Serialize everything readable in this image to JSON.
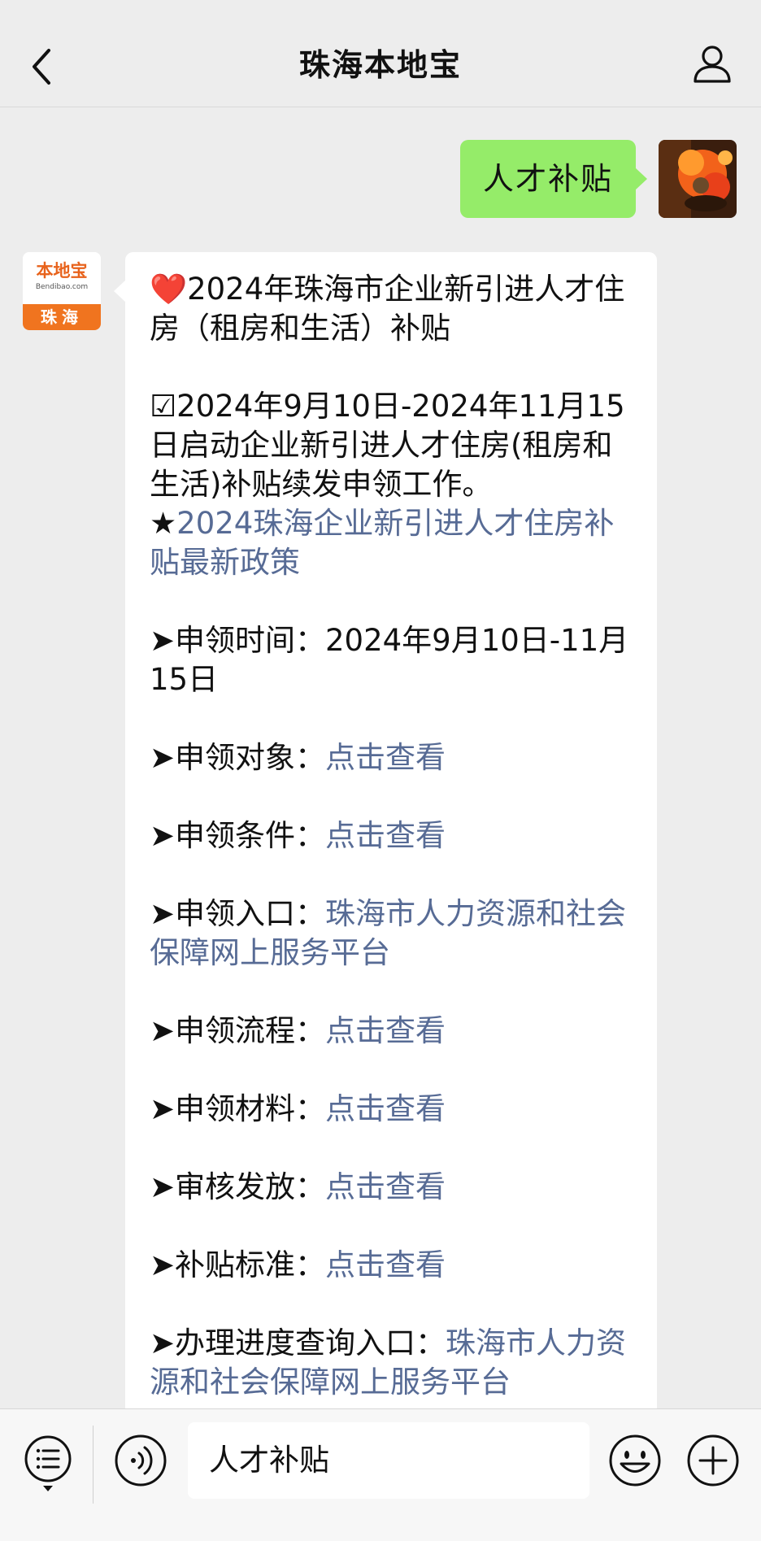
{
  "header": {
    "title": "珠海本地宝"
  },
  "icons": {
    "back": "chevron-left-icon",
    "profile": "person-icon",
    "menu": "list-menu-icon",
    "voice": "voice-icon",
    "emoji": "smiley-icon",
    "plus": "plus-icon"
  },
  "colors": {
    "user_bubble": "#95ec69",
    "link": "#576b95",
    "brand_orange": "#f0741f",
    "background": "#ededed"
  },
  "user_message": {
    "text": "人才补贴"
  },
  "bot_avatar": {
    "logo_name": "本地宝",
    "logo_url": "Bendibao.com",
    "logo_city": "珠海"
  },
  "bot_message": {
    "title_icon": "❤️",
    "title": "2024年珠海市企业新引进人才住房（租房和生活）补贴",
    "notice_icon": "☑",
    "notice": "2024年9月10日-2024年11月15日启动企业新引进人才住房(租房和生活)补贴续发申领工作。",
    "policy_star": "★",
    "policy_link": "2024珠海企业新引进人才住房补贴最新政策",
    "items": [
      {
        "label": "➤申领时间：",
        "value": "2024年9月10日-11月15日",
        "is_link": false
      },
      {
        "label": "➤申领对象：",
        "value": "点击查看",
        "is_link": true
      },
      {
        "label": "➤申领条件：",
        "value": "点击查看",
        "is_link": true
      },
      {
        "label": "➤申领入口：",
        "value": "珠海市人力资源和社会保障网上服务平台",
        "is_link": true
      },
      {
        "label": "➤申领流程：",
        "value": "点击查看",
        "is_link": true
      },
      {
        "label": "➤申领材料：",
        "value": "点击查看",
        "is_link": true
      },
      {
        "label": "➤审核发放：",
        "value": "点击查看",
        "is_link": true
      },
      {
        "label": "➤补贴标准：",
        "value": "点击查看",
        "is_link": true
      },
      {
        "label": "➤办理进度查询入口：",
        "value": "珠海市人力资源和社会保障网上服务平台",
        "is_link": true
      }
    ]
  },
  "input_bar": {
    "value": "人才补贴"
  }
}
